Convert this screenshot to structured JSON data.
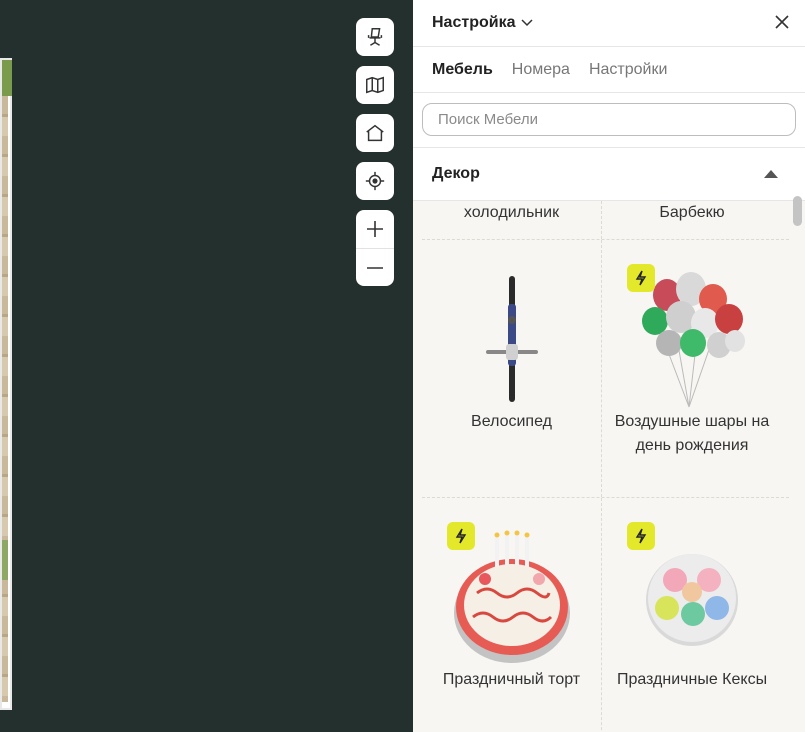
{
  "panel": {
    "title": "Настройка",
    "tabs": [
      {
        "label": "Мебель"
      },
      {
        "label": "Номера"
      },
      {
        "label": "Настройки"
      }
    ],
    "search_placeholder": "Поиск Мебели",
    "section": {
      "title": "Декор"
    }
  },
  "items": [
    {
      "name": "холодильник"
    },
    {
      "name": "Барбекю"
    },
    {
      "name": "Велосипед"
    },
    {
      "name": "Воздушные шары на день рождения"
    },
    {
      "name": "Праздничный торт"
    },
    {
      "name": "Праздничные Кексы"
    }
  ],
  "colors": {
    "badge": "#e4e82a",
    "canvas_bg": "#24302d"
  },
  "map_tools": [
    {
      "icon": "office-chair-icon"
    },
    {
      "icon": "map-icon"
    },
    {
      "icon": "home-icon"
    },
    {
      "icon": "locate-icon"
    },
    {
      "icon": "zoom-in-icon"
    },
    {
      "icon": "zoom-out-icon"
    }
  ]
}
